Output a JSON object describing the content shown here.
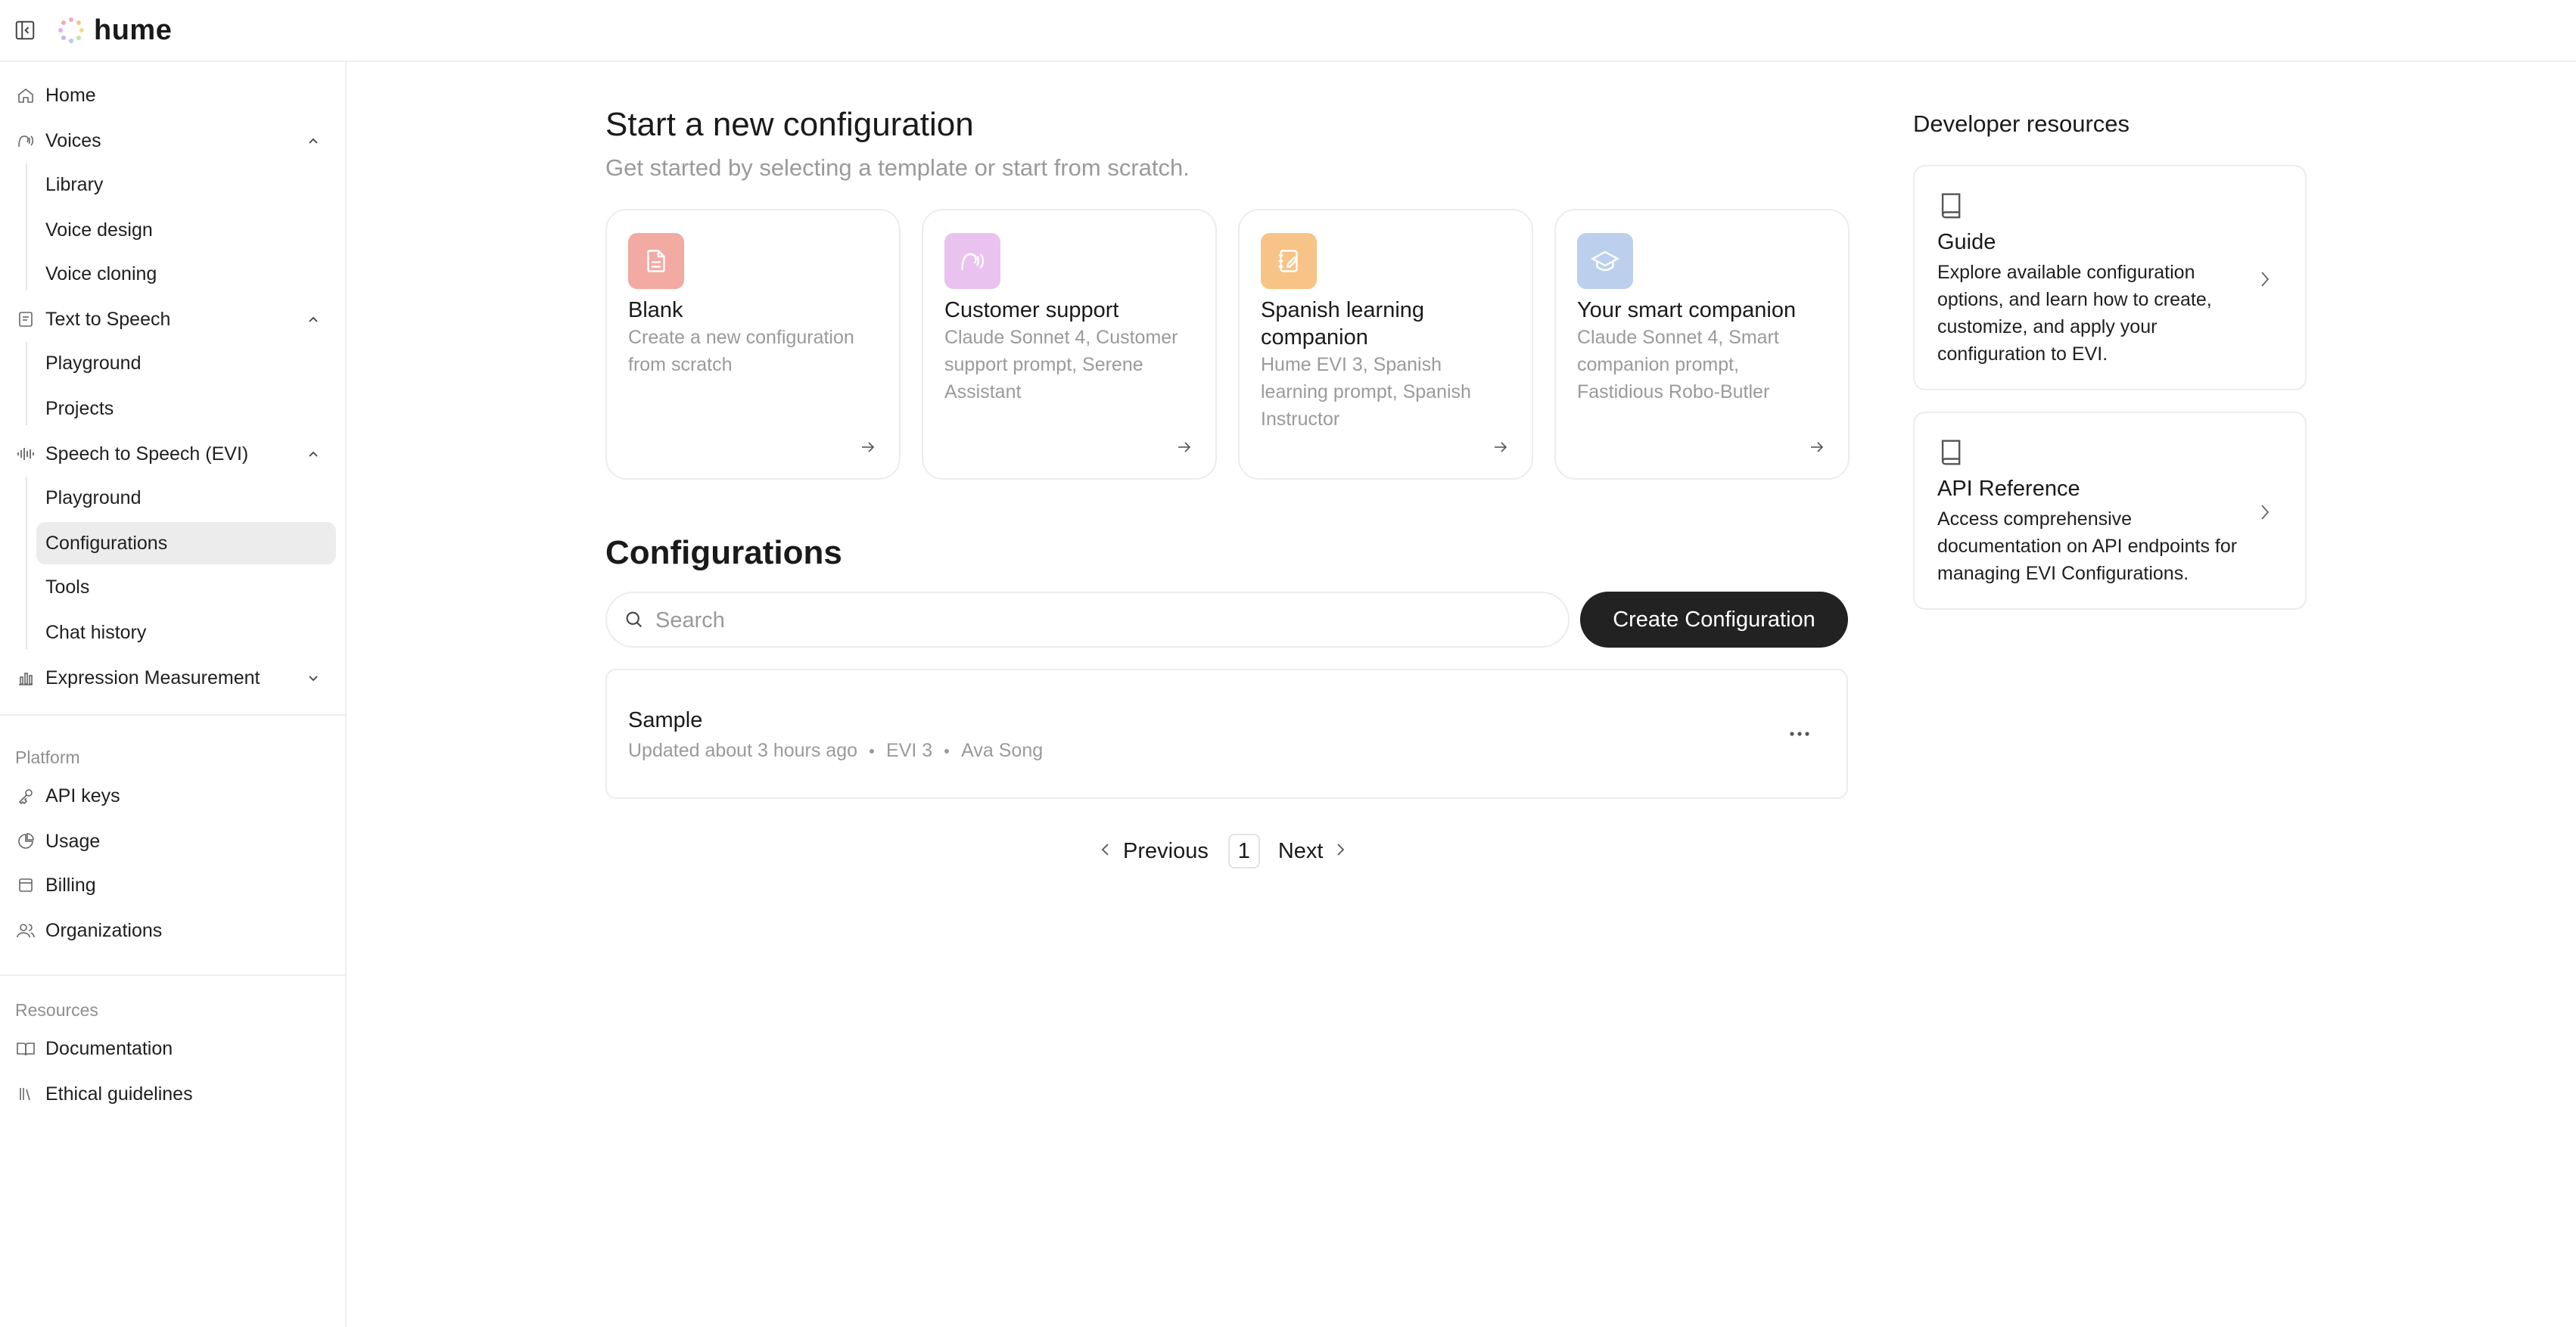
{
  "app": {
    "logo_text": "hume"
  },
  "sidebar": {
    "home": "Home",
    "voices": {
      "label": "Voices",
      "items": [
        "Library",
        "Voice design",
        "Voice cloning"
      ]
    },
    "tts": {
      "label": "Text to Speech",
      "items": [
        "Playground",
        "Projects"
      ]
    },
    "evi": {
      "label": "Speech to Speech (EVI)",
      "items": [
        "Playground",
        "Configurations",
        "Tools",
        "Chat history"
      ],
      "active": "Configurations"
    },
    "expression": {
      "label": "Expression Measurement"
    },
    "platform": {
      "label": "Platform",
      "items": [
        "API keys",
        "Usage",
        "Billing",
        "Organizations"
      ]
    },
    "resources": {
      "label": "Resources",
      "items": [
        "Documentation",
        "Ethical guidelines"
      ]
    }
  },
  "main": {
    "title": "Start a new configuration",
    "subtitle": "Get started by selecting a template or start from scratch.",
    "templates": [
      {
        "title": "Blank",
        "description": "Create a new configuration from scratch",
        "icon": "document-icon",
        "color": "#f2aaa3"
      },
      {
        "title": "Customer support",
        "description": "Claude Sonnet 4, Customer support prompt, Serene Assistant",
        "icon": "voice-icon",
        "color": "#e9c2ef"
      },
      {
        "title": "Spanish learning companion",
        "description": "Hume EVI 3, Spanish learning prompt, Spanish Instructor",
        "icon": "notebook-icon",
        "color": "#f7c386"
      },
      {
        "title": "Your smart companion",
        "description": "Claude Sonnet 4, Smart companion prompt, Fastidious Robo-Butler",
        "icon": "graduation-cap-icon",
        "color": "#bcd0ee"
      }
    ],
    "configurations_title": "Configurations",
    "search": {
      "placeholder": "Search",
      "value": ""
    },
    "create_button": "Create Configuration",
    "configs": [
      {
        "name": "Sample",
        "updated": "Updated about 3 hours ago",
        "model": "EVI 3",
        "voice": "Ava Song"
      }
    ],
    "pagination": {
      "previous": "Previous",
      "page": "1",
      "next": "Next"
    }
  },
  "developer": {
    "title": "Developer resources",
    "cards": [
      {
        "name": "Guide",
        "description": "Explore available configuration options, and learn how to create, customize, and apply your configuration to EVI."
      },
      {
        "name": "API Reference",
        "description": "Access comprehensive documentation on API endpoints for managing EVI Configurations."
      }
    ]
  }
}
